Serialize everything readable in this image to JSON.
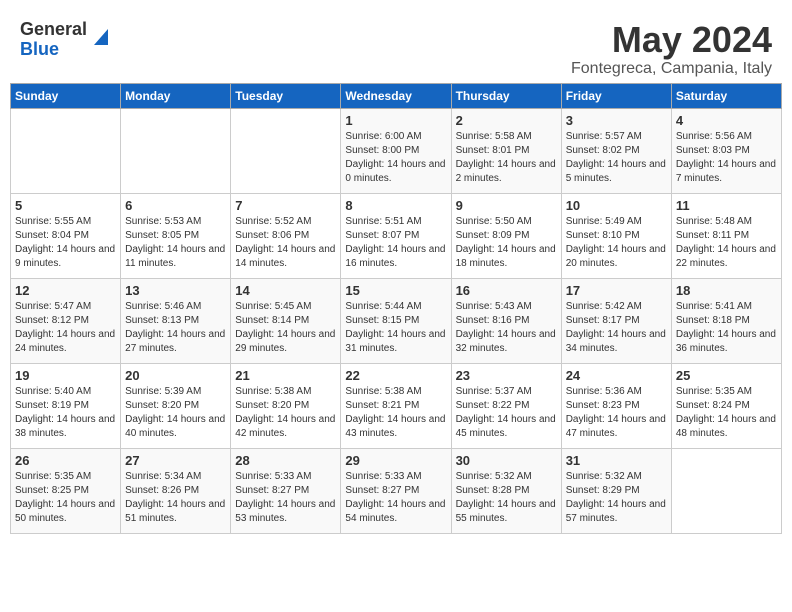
{
  "header": {
    "logo_line1": "General",
    "logo_line2": "Blue",
    "month": "May 2024",
    "location": "Fontegreca, Campania, Italy"
  },
  "weekdays": [
    "Sunday",
    "Monday",
    "Tuesday",
    "Wednesday",
    "Thursday",
    "Friday",
    "Saturday"
  ],
  "weeks": [
    [
      {
        "day": "",
        "sunrise": "",
        "sunset": "",
        "daylight": ""
      },
      {
        "day": "",
        "sunrise": "",
        "sunset": "",
        "daylight": ""
      },
      {
        "day": "",
        "sunrise": "",
        "sunset": "",
        "daylight": ""
      },
      {
        "day": "1",
        "sunrise": "Sunrise: 6:00 AM",
        "sunset": "Sunset: 8:00 PM",
        "daylight": "Daylight: 14 hours and 0 minutes."
      },
      {
        "day": "2",
        "sunrise": "Sunrise: 5:58 AM",
        "sunset": "Sunset: 8:01 PM",
        "daylight": "Daylight: 14 hours and 2 minutes."
      },
      {
        "day": "3",
        "sunrise": "Sunrise: 5:57 AM",
        "sunset": "Sunset: 8:02 PM",
        "daylight": "Daylight: 14 hours and 5 minutes."
      },
      {
        "day": "4",
        "sunrise": "Sunrise: 5:56 AM",
        "sunset": "Sunset: 8:03 PM",
        "daylight": "Daylight: 14 hours and 7 minutes."
      }
    ],
    [
      {
        "day": "5",
        "sunrise": "Sunrise: 5:55 AM",
        "sunset": "Sunset: 8:04 PM",
        "daylight": "Daylight: 14 hours and 9 minutes."
      },
      {
        "day": "6",
        "sunrise": "Sunrise: 5:53 AM",
        "sunset": "Sunset: 8:05 PM",
        "daylight": "Daylight: 14 hours and 11 minutes."
      },
      {
        "day": "7",
        "sunrise": "Sunrise: 5:52 AM",
        "sunset": "Sunset: 8:06 PM",
        "daylight": "Daylight: 14 hours and 14 minutes."
      },
      {
        "day": "8",
        "sunrise": "Sunrise: 5:51 AM",
        "sunset": "Sunset: 8:07 PM",
        "daylight": "Daylight: 14 hours and 16 minutes."
      },
      {
        "day": "9",
        "sunrise": "Sunrise: 5:50 AM",
        "sunset": "Sunset: 8:09 PM",
        "daylight": "Daylight: 14 hours and 18 minutes."
      },
      {
        "day": "10",
        "sunrise": "Sunrise: 5:49 AM",
        "sunset": "Sunset: 8:10 PM",
        "daylight": "Daylight: 14 hours and 20 minutes."
      },
      {
        "day": "11",
        "sunrise": "Sunrise: 5:48 AM",
        "sunset": "Sunset: 8:11 PM",
        "daylight": "Daylight: 14 hours and 22 minutes."
      }
    ],
    [
      {
        "day": "12",
        "sunrise": "Sunrise: 5:47 AM",
        "sunset": "Sunset: 8:12 PM",
        "daylight": "Daylight: 14 hours and 24 minutes."
      },
      {
        "day": "13",
        "sunrise": "Sunrise: 5:46 AM",
        "sunset": "Sunset: 8:13 PM",
        "daylight": "Daylight: 14 hours and 27 minutes."
      },
      {
        "day": "14",
        "sunrise": "Sunrise: 5:45 AM",
        "sunset": "Sunset: 8:14 PM",
        "daylight": "Daylight: 14 hours and 29 minutes."
      },
      {
        "day": "15",
        "sunrise": "Sunrise: 5:44 AM",
        "sunset": "Sunset: 8:15 PM",
        "daylight": "Daylight: 14 hours and 31 minutes."
      },
      {
        "day": "16",
        "sunrise": "Sunrise: 5:43 AM",
        "sunset": "Sunset: 8:16 PM",
        "daylight": "Daylight: 14 hours and 32 minutes."
      },
      {
        "day": "17",
        "sunrise": "Sunrise: 5:42 AM",
        "sunset": "Sunset: 8:17 PM",
        "daylight": "Daylight: 14 hours and 34 minutes."
      },
      {
        "day": "18",
        "sunrise": "Sunrise: 5:41 AM",
        "sunset": "Sunset: 8:18 PM",
        "daylight": "Daylight: 14 hours and 36 minutes."
      }
    ],
    [
      {
        "day": "19",
        "sunrise": "Sunrise: 5:40 AM",
        "sunset": "Sunset: 8:19 PM",
        "daylight": "Daylight: 14 hours and 38 minutes."
      },
      {
        "day": "20",
        "sunrise": "Sunrise: 5:39 AM",
        "sunset": "Sunset: 8:20 PM",
        "daylight": "Daylight: 14 hours and 40 minutes."
      },
      {
        "day": "21",
        "sunrise": "Sunrise: 5:38 AM",
        "sunset": "Sunset: 8:20 PM",
        "daylight": "Daylight: 14 hours and 42 minutes."
      },
      {
        "day": "22",
        "sunrise": "Sunrise: 5:38 AM",
        "sunset": "Sunset: 8:21 PM",
        "daylight": "Daylight: 14 hours and 43 minutes."
      },
      {
        "day": "23",
        "sunrise": "Sunrise: 5:37 AM",
        "sunset": "Sunset: 8:22 PM",
        "daylight": "Daylight: 14 hours and 45 minutes."
      },
      {
        "day": "24",
        "sunrise": "Sunrise: 5:36 AM",
        "sunset": "Sunset: 8:23 PM",
        "daylight": "Daylight: 14 hours and 47 minutes."
      },
      {
        "day": "25",
        "sunrise": "Sunrise: 5:35 AM",
        "sunset": "Sunset: 8:24 PM",
        "daylight": "Daylight: 14 hours and 48 minutes."
      }
    ],
    [
      {
        "day": "26",
        "sunrise": "Sunrise: 5:35 AM",
        "sunset": "Sunset: 8:25 PM",
        "daylight": "Daylight: 14 hours and 50 minutes."
      },
      {
        "day": "27",
        "sunrise": "Sunrise: 5:34 AM",
        "sunset": "Sunset: 8:26 PM",
        "daylight": "Daylight: 14 hours and 51 minutes."
      },
      {
        "day": "28",
        "sunrise": "Sunrise: 5:33 AM",
        "sunset": "Sunset: 8:27 PM",
        "daylight": "Daylight: 14 hours and 53 minutes."
      },
      {
        "day": "29",
        "sunrise": "Sunrise: 5:33 AM",
        "sunset": "Sunset: 8:27 PM",
        "daylight": "Daylight: 14 hours and 54 minutes."
      },
      {
        "day": "30",
        "sunrise": "Sunrise: 5:32 AM",
        "sunset": "Sunset: 8:28 PM",
        "daylight": "Daylight: 14 hours and 55 minutes."
      },
      {
        "day": "31",
        "sunrise": "Sunrise: 5:32 AM",
        "sunset": "Sunset: 8:29 PM",
        "daylight": "Daylight: 14 hours and 57 minutes."
      },
      {
        "day": "",
        "sunrise": "",
        "sunset": "",
        "daylight": ""
      }
    ]
  ]
}
